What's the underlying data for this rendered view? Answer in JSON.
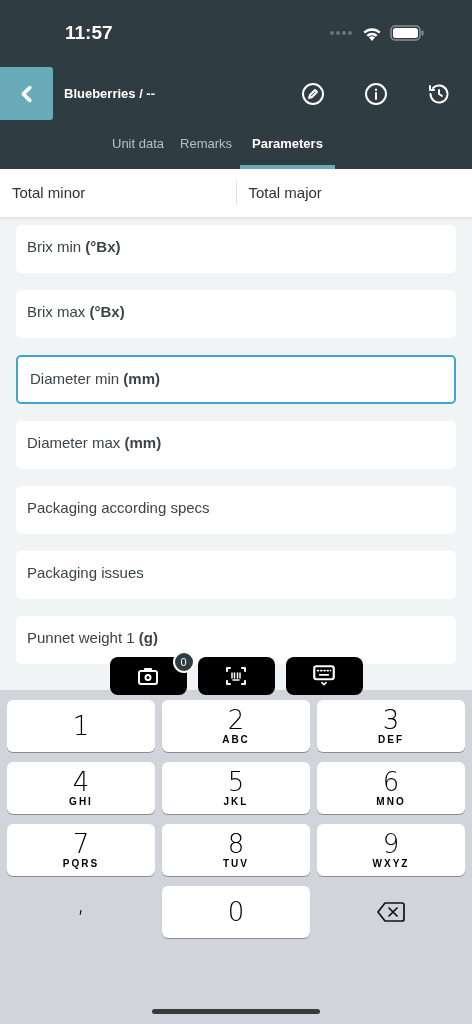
{
  "status_bar": {
    "time": "11:57"
  },
  "header": {
    "title": "Blueberries / --"
  },
  "tabs": [
    {
      "label": "Unit data",
      "selected": false
    },
    {
      "label": "Remarks",
      "selected": false
    },
    {
      "label": "Parameters",
      "selected": true
    }
  ],
  "totals": [
    "Total minor",
    "Total major"
  ],
  "fields": [
    {
      "label": "Brix min",
      "unit": "(°Bx)",
      "selected": false
    },
    {
      "label": "Brix max",
      "unit": "(°Bx)",
      "selected": false
    },
    {
      "label": "Diameter min",
      "unit": "(mm)",
      "selected": true
    },
    {
      "label": "Diameter max",
      "unit": "(mm)",
      "selected": false
    },
    {
      "label": "Packaging according specs",
      "selected": false
    },
    {
      "label": "Packaging issues",
      "selected": false
    },
    {
      "label": "Punnet weight 1",
      "unit": "(g)",
      "selected": false
    }
  ],
  "toolbar": {
    "photo_count": "0"
  },
  "keyboard_rows": [
    {
      "keys": [
        {
          "kind": "digit",
          "digit": "1"
        },
        {
          "kind": "digit",
          "digit": "2",
          "letters": "ABC"
        },
        {
          "kind": "digit",
          "digit": "3",
          "letters": "DEF"
        }
      ]
    },
    {
      "keys": [
        {
          "kind": "digit",
          "digit": "4",
          "letters": "GHI"
        },
        {
          "kind": "digit",
          "digit": "5",
          "letters": "JKL"
        },
        {
          "kind": "digit",
          "digit": "6",
          "letters": "MNO"
        }
      ]
    },
    {
      "keys": [
        {
          "kind": "digit",
          "digit": "7",
          "letters": "PQRS"
        },
        {
          "kind": "digit",
          "digit": "8",
          "letters": "TUV"
        },
        {
          "kind": "digit",
          "digit": "9",
          "letters": "WXYZ"
        }
      ]
    },
    {
      "keys": [
        {
          "kind": "plain",
          "digit": ","
        },
        {
          "kind": "digit",
          "digit": "0"
        },
        {
          "kind": "backspace"
        }
      ]
    }
  ]
}
